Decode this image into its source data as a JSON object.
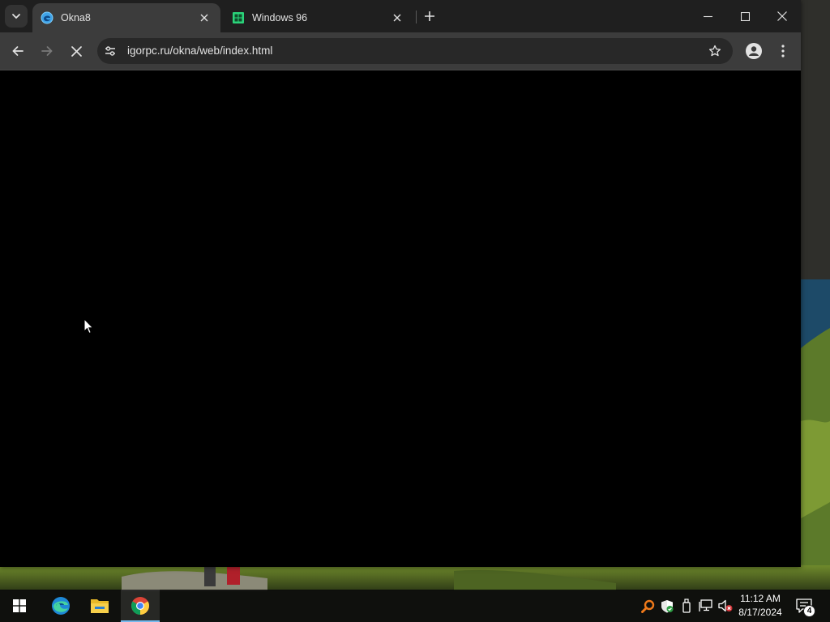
{
  "browser": {
    "tabs": [
      {
        "title": "Okna8",
        "active": true,
        "favicon": "edge-like-blue-icon"
      },
      {
        "title": "Windows 96",
        "active": false,
        "favicon": "windows96-green-icon"
      }
    ],
    "address_bar": {
      "url": "igorpc.ru/okna/web/index.html"
    },
    "page_loading": true
  },
  "taskbar": {
    "pinned": [
      "start-icon",
      "edge-icon",
      "file-explorer-icon",
      "chrome-icon"
    ],
    "active_app": "chrome",
    "tray_icons": [
      "search-magnifier-icon",
      "defender-shield-icon",
      "usb-device-icon",
      "network-icon",
      "volume-muted-icon"
    ],
    "clock": {
      "time": "11:12 AM",
      "date": "8/17/2024"
    },
    "notifications": {
      "count": "4"
    }
  },
  "colors": {
    "titlebar": "#1f1f1f",
    "toolbar": "#3c3c3c",
    "active_tab": "#3c3c3c",
    "omnibox": "#282828",
    "page": "#000000",
    "taskbar_accent": "#76b9ed"
  }
}
